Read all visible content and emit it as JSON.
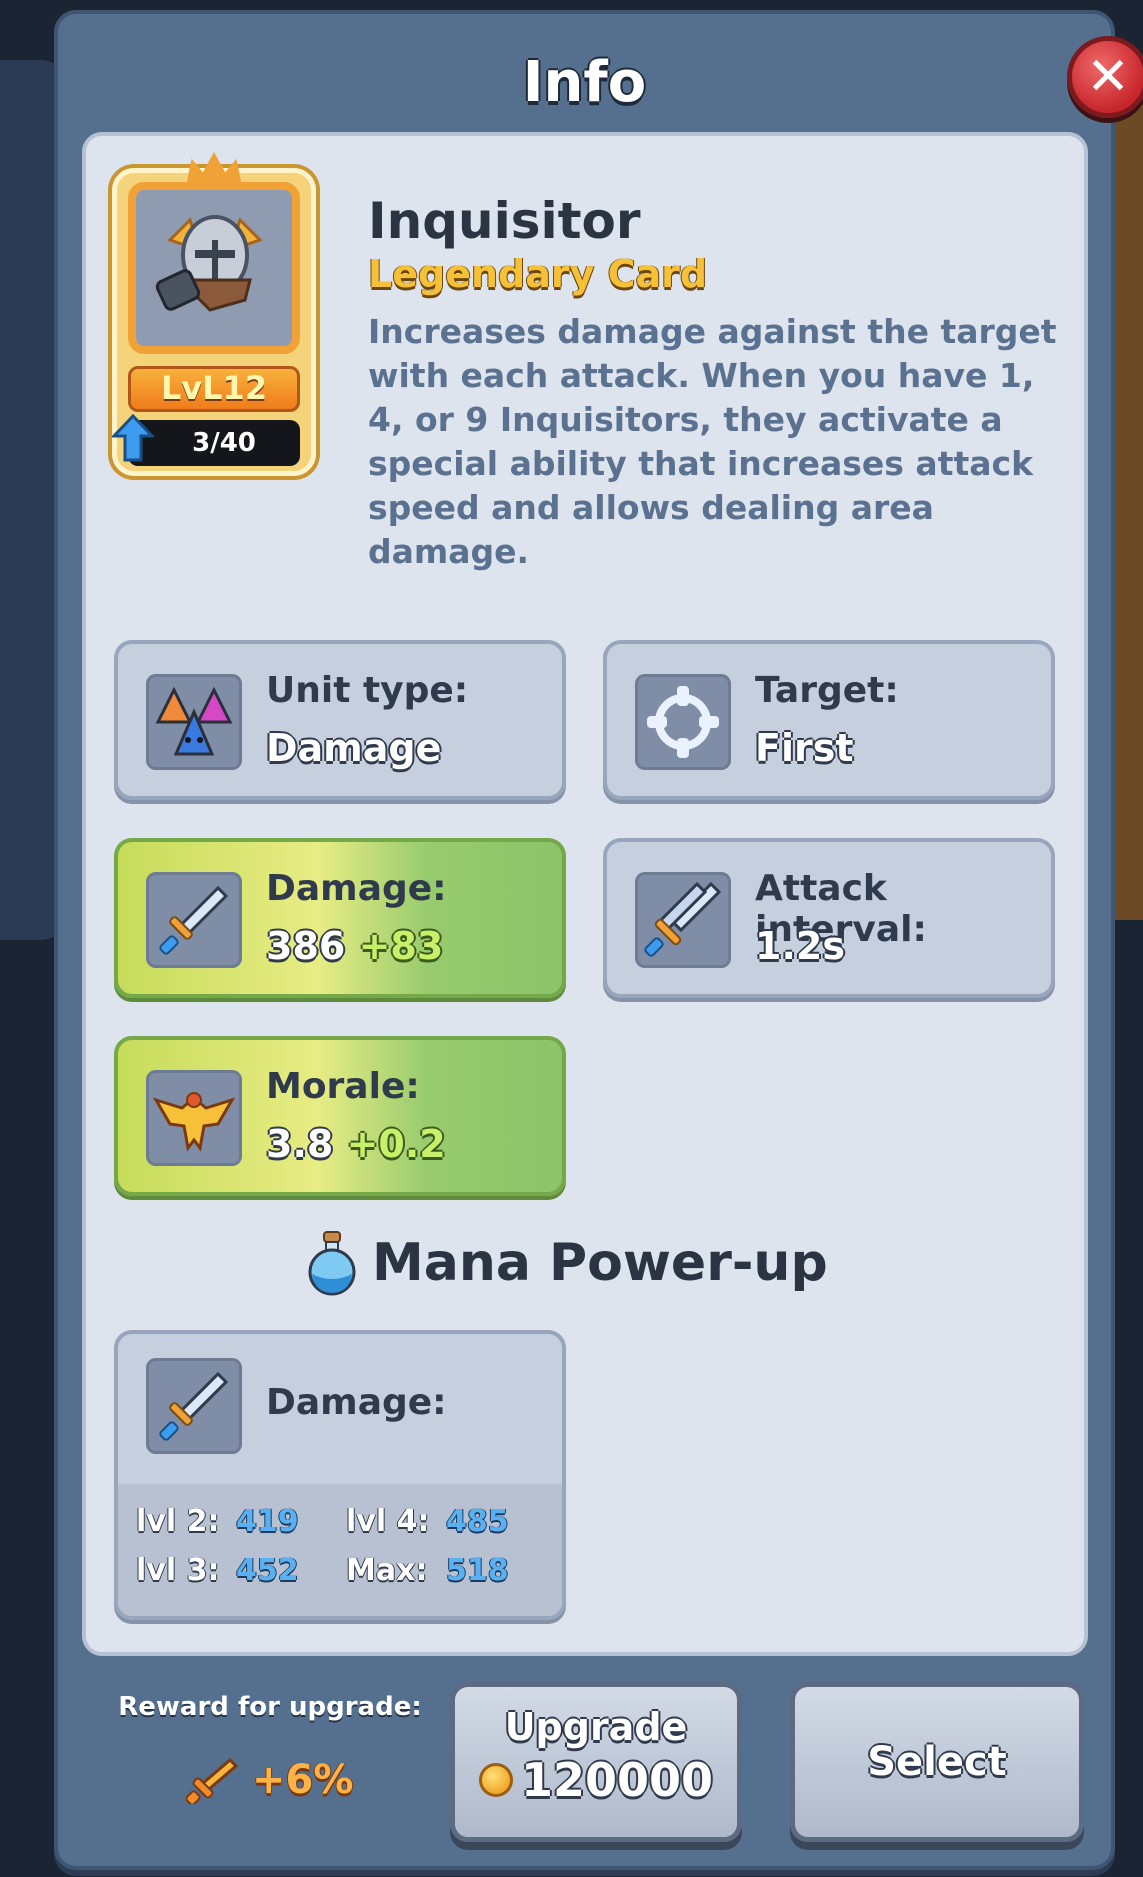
{
  "modal": {
    "title": "Info",
    "close_icon": "close-x-icon"
  },
  "card": {
    "name": "Inquisitor",
    "rarity": "Legendary Card",
    "level": "LvL12",
    "progress": "3/40",
    "progress_fraction": 0.075,
    "description": "Increases damage against the target with each attack. When you have 1, 4, or 9 Inquisitors, they activate a special ability that increases attack speed and allows dealing area damage."
  },
  "stats": {
    "unit_type": {
      "label": "Unit type:",
      "value": "Damage",
      "icon": "mage-trio-icon"
    },
    "target": {
      "label": "Target:",
      "value": "First",
      "icon": "crosshair-icon"
    },
    "damage": {
      "label": "Damage:",
      "value": "386",
      "bonus": "+83",
      "icon": "sword-icon"
    },
    "attack_interval": {
      "label": "Attack interval:",
      "value": "1.2s",
      "icon": "swords-icon"
    },
    "morale": {
      "label": "Morale:",
      "value": "3.8",
      "bonus": "+0.2",
      "icon": "eagle-emblem-icon"
    }
  },
  "mana": {
    "title": "Mana Power-up",
    "icon": "mana-potion-icon",
    "card_label": "Damage:",
    "card_icon": "sword-icon",
    "levels": [
      {
        "key": "lvl 2:",
        "value": "419"
      },
      {
        "key": "lvl 4:",
        "value": "485"
      },
      {
        "key": "lvl 3:",
        "value": "452"
      },
      {
        "key": "Max:",
        "value": "518"
      }
    ]
  },
  "footer": {
    "reward_label": "Reward for upgrade:",
    "reward_value": "+6%",
    "reward_icon": "sword-icon",
    "upgrade_label": "Upgrade",
    "upgrade_price": "120000",
    "upgrade_currency_icon": "coin-icon",
    "select_label": "Select"
  },
  "colors": {
    "modal_bg": "#55708f",
    "panel_bg": "#dde4ee",
    "rarity_gold": "#f6c038",
    "description_text": "#5b7190",
    "boost_green": "#8dc46a",
    "mana_value_blue": "#5ab0f0"
  }
}
